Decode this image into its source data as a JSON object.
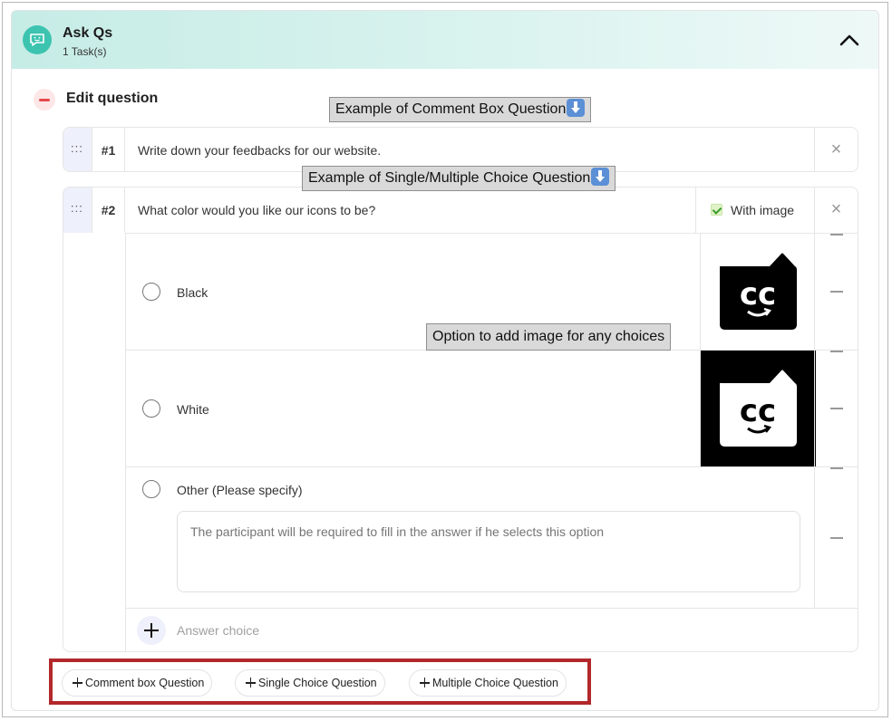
{
  "header": {
    "title": "Ask Qs",
    "subtitle": "1 Task(s)",
    "icon": "chat-bubble-icon",
    "toggle_icon": "chevron-up-icon"
  },
  "section": {
    "label": "Edit question",
    "icon": "minus-circle-icon"
  },
  "callouts": {
    "comment_box": "Example of Comment Box Question",
    "single_multiple": "Example of Single/Multiple Choice Question",
    "image_option": "Option to add image for any choices"
  },
  "questions": [
    {
      "number": "#1",
      "text": "Write down your feedbacks for our website."
    },
    {
      "number": "#2",
      "text": "What color would you like our icons to be?",
      "with_image_label": "With image",
      "with_image_checked": true,
      "choices": [
        {
          "label": "Black",
          "image": "cc-logo-black-icon"
        },
        {
          "label": "White",
          "image": "cc-logo-white-icon"
        },
        {
          "label": "Other (Please specify)",
          "placeholder": "The participant will be required to fill in the answer if he selects this option"
        }
      ],
      "add_choice_label": "Answer choice"
    }
  ],
  "add_buttons": {
    "comment_box": "Comment box Question",
    "single_choice": "Single Choice Question",
    "multiple_choice": "Multiple Choice Question"
  },
  "colors": {
    "header_gradient_start": "#c6ece6",
    "header_icon": "#3cc4b0",
    "remove_accent": "#e5484d",
    "highlight_border": "#b2282b"
  }
}
